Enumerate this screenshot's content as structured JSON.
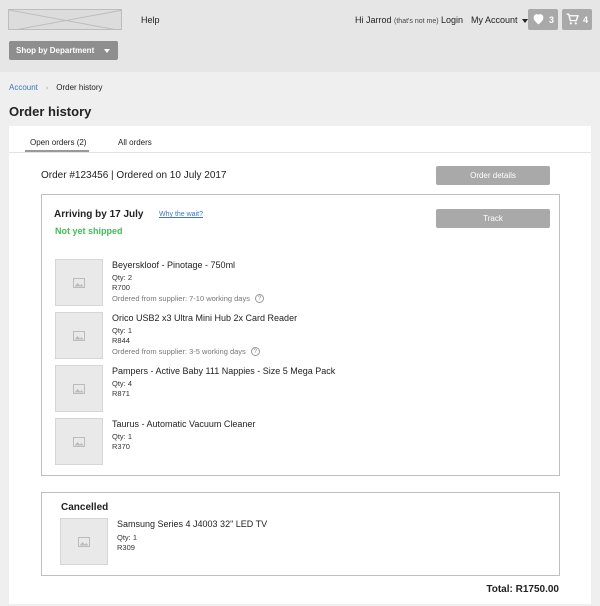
{
  "header": {
    "help": "Help",
    "greeting": "Hi Jarrod",
    "not_me": "(that's not me)",
    "login": "Login",
    "my_account": "My Account",
    "wishlist_count": "3",
    "cart_count": "4",
    "shop_by_department": "Shop by Department"
  },
  "breadcrumb": {
    "account": "Account",
    "current": "Order history"
  },
  "page_title": "Order history",
  "tabs": {
    "open": "Open orders (2)",
    "all": "All orders"
  },
  "order": {
    "heading": "Order #123456 | Ordered on 10 July 2017",
    "details_button": "Order details",
    "arriving": "Arriving by 17 July",
    "why_wait": "Why the wait?",
    "status": "Not yet shipped",
    "track_button": "Track",
    "items": [
      {
        "name": "Beyerskloof - Pinotage - 750ml",
        "qty": "Qty: 2",
        "price": "R700",
        "supplier": "Ordered from supplier: 7-10 working days"
      },
      {
        "name": "Orico USB2 x3 Ultra Mini Hub 2x Card Reader",
        "qty": "Qty: 1",
        "price": "R844",
        "supplier": "Ordered from supplier: 3-5 working days"
      },
      {
        "name": "Pampers - Active Baby 111 Nappies - Size 5 Mega Pack",
        "qty": "Qty: 4",
        "price": "R871"
      },
      {
        "name": "Taurus - Automatic Vacuum Cleaner",
        "qty": "Qty: 1",
        "price": "R370"
      }
    ],
    "cancelled": {
      "title": "Cancelled",
      "item": {
        "name": "Samsung Series 4 J4003 32\" LED TV",
        "qty": "Qty: 1",
        "price": "R309"
      }
    },
    "total": "Total: R1750.00"
  },
  "colors": {
    "link": "#3a78c4",
    "success": "#3fbf55",
    "button_gray": "#a9a9a9"
  }
}
